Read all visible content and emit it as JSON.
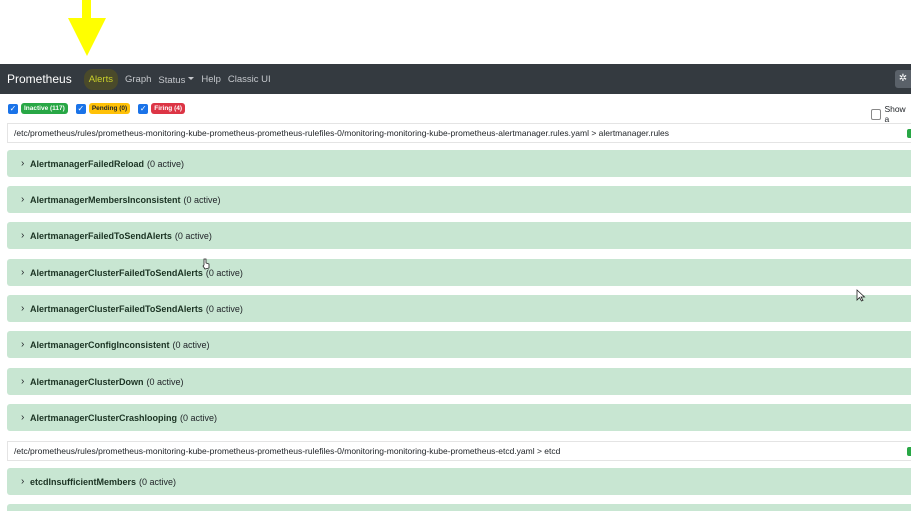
{
  "navbar": {
    "brand": "Prometheus",
    "items": [
      "Alerts",
      "Graph",
      "Status",
      "Help",
      "Classic UI"
    ],
    "theme_icon": "gear-icon"
  },
  "filters": {
    "inactive": "Inactive (117)",
    "pending": "Pending (0)",
    "firing": "Firing (4)",
    "show_annotations": "Show a"
  },
  "groups": [
    {
      "path": "/etc/prometheus/rules/prometheus-monitoring-kube-prometheus-prometheus-rulefiles-0/monitoring-monitoring-kube-prometheus-alertmanager.rules.yaml > alertmanager.rules",
      "rules": [
        {
          "name": "AlertmanagerFailedReload",
          "active": "(0 active)"
        },
        {
          "name": "AlertmanagerMembersInconsistent",
          "active": "(0 active)"
        },
        {
          "name": "AlertmanagerFailedToSendAlerts",
          "active": "(0 active)"
        },
        {
          "name": "AlertmanagerClusterFailedToSendAlerts",
          "active": "(0 active)"
        },
        {
          "name": "AlertmanagerClusterFailedToSendAlerts",
          "active": "(0 active)"
        },
        {
          "name": "AlertmanagerConfigInconsistent",
          "active": "(0 active)"
        },
        {
          "name": "AlertmanagerClusterDown",
          "active": "(0 active)"
        },
        {
          "name": "AlertmanagerClusterCrashlooping",
          "active": "(0 active)"
        }
      ]
    },
    {
      "path": "/etc/prometheus/rules/prometheus-monitoring-kube-prometheus-prometheus-rulefiles-0/monitoring-monitoring-kube-prometheus-etcd.yaml > etcd",
      "rules": [
        {
          "name": "etcdInsufficientMembers",
          "active": "(0 active)"
        }
      ]
    }
  ],
  "colors": {
    "navbar_bg": "#343a40",
    "rule_row_bg": "#c8e6d2",
    "inactive_badge": "#28a745",
    "pending_badge": "#ffc107",
    "firing_badge": "#dc3545",
    "annotation_arrow": "#ffff00"
  }
}
